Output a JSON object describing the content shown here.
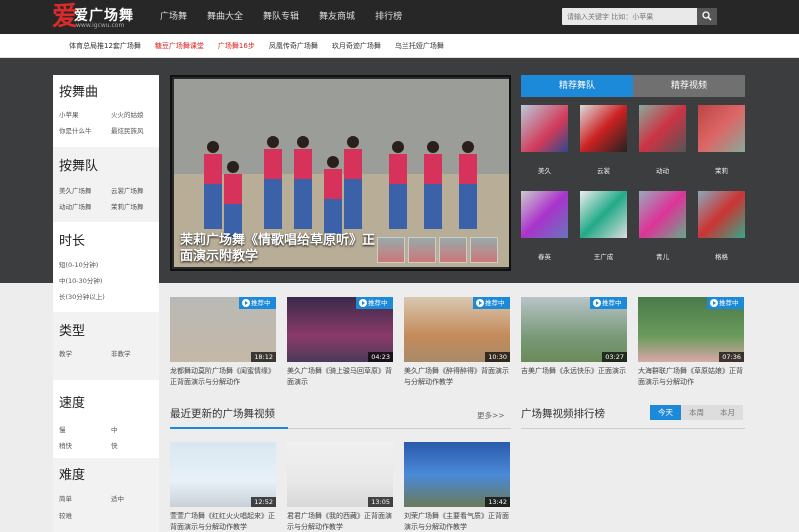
{
  "header": {
    "logo_mark": "爱",
    "logo_text": "爱广场舞",
    "logo_url": "www.igcwu.com",
    "nav": [
      "广场舞",
      "舞曲大全",
      "舞队专辑",
      "舞友商城",
      "排行榜"
    ],
    "search_placeholder": "请输入关键字 比如：小苹果"
  },
  "subnav": [
    {
      "label": "体育总局推12套广场舞",
      "highlight": false
    },
    {
      "label": "糖豆广场舞课堂",
      "highlight": true
    },
    {
      "label": "广场舞16步",
      "highlight": true
    },
    {
      "label": "凤凰传奇广场舞",
      "highlight": false
    },
    {
      "label": "玖月奇迹广场舞",
      "highlight": false
    },
    {
      "label": "乌兰托娅广场舞",
      "highlight": false
    }
  ],
  "sidebar": {
    "dance": {
      "title": "按舞曲",
      "items": [
        "小苹果",
        "火火的姑娘",
        "你是什么牛",
        "最炫民族风"
      ]
    },
    "team": {
      "title": "按舞队",
      "items": [
        "美久广场舞",
        "云裳广场舞",
        "动动广场舞",
        "茉莉广场舞"
      ]
    },
    "duration": {
      "title": "时长",
      "items": [
        "短(0-10分钟)",
        "中(10-30分钟)",
        "长(30分钟以上)"
      ]
    },
    "type": {
      "title": "类型",
      "items": [
        "教学",
        "非教学"
      ]
    },
    "speed": {
      "title": "速度",
      "items": [
        "慢",
        "中",
        "稍快",
        "快"
      ]
    },
    "difficulty": {
      "title": "难度",
      "items": [
        "简单",
        "适中",
        "较难"
      ]
    }
  },
  "hero": {
    "caption": "茉莉广场舞《情歌唱给草原听》正面演示附教学"
  },
  "right_tabs": [
    "精荐舞队",
    "精荐视频"
  ],
  "teams": [
    "美久",
    "云裳",
    "动动",
    "茉莉",
    "春英",
    "王广成",
    "青儿",
    "格格"
  ],
  "recommended": [
    {
      "badge": "推荐中",
      "duration": "18:12",
      "title": "龙都舞动莫阶广场舞《闺蜜情缘》正背面演示与分解动作"
    },
    {
      "badge": "推荐中",
      "duration": "04:23",
      "title": "美久广场舞《骑上骏马回草原》背面演示"
    },
    {
      "badge": "推荐中",
      "duration": "10:30",
      "title": "美久广场舞《醉得醉得》背面演示与分解动作教学"
    },
    {
      "badge": "推荐中",
      "duration": "03:27",
      "title": "吉美广场舞《永远快乐》正面演示"
    },
    {
      "badge": "推荐中",
      "duration": "07:36",
      "title": "大海群联广场舞《草原姑娘》正背面演示与分解动作"
    }
  ],
  "latest": {
    "heading": "最近更新的广场舞视频",
    "more": "更多>>",
    "videos": [
      {
        "duration": "12:52",
        "title": "萱萱广场舞《红红火火唱起来》正背面演示与分解动作教学"
      },
      {
        "duration": "13:05",
        "title": "君君广场舞《我的西藏》正背面演示与分解动作教学"
      },
      {
        "duration": "13:42",
        "title": "刘荣广场舞《主要看气质》正背面演示与分解动作教学"
      }
    ]
  },
  "ranking": {
    "heading": "广场舞视频排行榜",
    "tabs": [
      "今天",
      "本周",
      "本月"
    ]
  }
}
